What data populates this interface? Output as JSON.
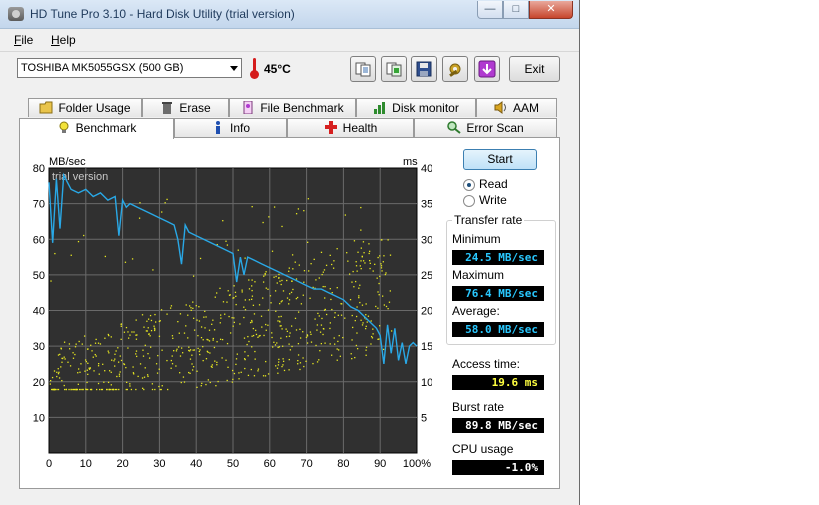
{
  "window": {
    "title": "HD Tune Pro 3.10 - Hard Disk Utility (trial version)",
    "controls": {
      "minimize": "—",
      "maximize": "□",
      "close": "✕"
    }
  },
  "menu": {
    "file": "File",
    "file_hotkey": "F",
    "file_rest": "ile",
    "help": "Help",
    "help_hotkey": "H",
    "help_rest": "elp"
  },
  "toolbar": {
    "drive": "TOSHIBA MK5055GSX (500 GB)",
    "temperature": "45°C",
    "exit_label": "Exit",
    "icons": [
      "copy-info-icon",
      "copy-screenshot-icon",
      "save-icon",
      "options-icon",
      "minimize-to-tray-icon"
    ]
  },
  "tabs": {
    "row1": [
      {
        "label": "Folder Usage",
        "icon": "folder-icon"
      },
      {
        "label": "Erase",
        "icon": "trash-icon"
      },
      {
        "label": "File Benchmark",
        "icon": "file-benchmark-icon"
      },
      {
        "label": "Disk monitor",
        "icon": "disk-monitor-icon"
      },
      {
        "label": "AAM",
        "icon": "speaker-icon"
      }
    ],
    "row2": [
      {
        "label": "Benchmark",
        "icon": "lightbulb-icon",
        "active": true
      },
      {
        "label": "Info",
        "icon": "info-icon"
      },
      {
        "label": "Health",
        "icon": "health-cross-icon"
      },
      {
        "label": "Error Scan",
        "icon": "magnifier-icon"
      }
    ]
  },
  "benchmark": {
    "start_label": "Start",
    "read_label": "Read",
    "write_label": "Write",
    "mode": "read",
    "transfer_rate_title": "Transfer rate",
    "minimum_label": "Minimum",
    "minimum_value": "24.5 MB/sec",
    "maximum_label": "Maximum",
    "maximum_value": "76.4 MB/sec",
    "average_label": "Average:",
    "average_value": "58.0 MB/sec",
    "access_time_label": "Access time:",
    "access_time_value": "19.6 ms",
    "burst_rate_label": "Burst rate",
    "burst_rate_value": "89.8 MB/sec",
    "cpu_usage_label": "CPU usage",
    "cpu_usage_value": "-1.0%",
    "value_color_cyan": "#29c8ff",
    "value_color_yellow": "#ffff40"
  },
  "chart_data": {
    "type": "line",
    "watermark": "trial version",
    "ylabel_left": "MB/sec",
    "ylabel_right": "ms",
    "ylim_left": [
      0,
      80
    ],
    "ylim_right": [
      0,
      40
    ],
    "xlim": [
      0,
      100
    ],
    "yticks_left": [
      "10",
      "20",
      "30",
      "40",
      "50",
      "60",
      "70",
      "80"
    ],
    "yticks_right": [
      "5",
      "10",
      "15",
      "20",
      "25",
      "30",
      "35",
      "40"
    ],
    "xticks": [
      "0",
      "10",
      "20",
      "30",
      "40",
      "50",
      "60",
      "70",
      "80",
      "90",
      "100%"
    ],
    "grid": true,
    "background": "#303030",
    "grid_color": "#6a6a6a",
    "series": [
      {
        "color": "#29a8e6",
        "x": [
          0,
          1,
          2,
          3,
          4,
          5,
          6,
          8,
          10,
          12,
          14,
          16,
          18,
          19,
          20,
          21,
          22,
          24,
          26,
          28,
          30,
          32,
          34,
          35,
          36,
          37,
          38,
          40,
          42,
          44,
          46,
          48,
          50,
          51,
          52,
          53,
          54,
          56,
          58,
          60,
          62,
          64,
          66,
          68,
          70,
          72,
          74,
          76,
          78,
          80,
          82,
          84,
          86,
          88,
          89,
          90,
          91,
          92,
          93,
          94,
          95,
          96,
          97,
          98,
          99,
          100
        ],
        "y": [
          76,
          59,
          77,
          63,
          78,
          76,
          74,
          73,
          74,
          72,
          73,
          71,
          72,
          61,
          71,
          69,
          70,
          69,
          68,
          67,
          66,
          65,
          64,
          60,
          53,
          64,
          62,
          61,
          60,
          59,
          58,
          57,
          56,
          48,
          55,
          50,
          55,
          54,
          53,
          52,
          51,
          50,
          49,
          48,
          47,
          46,
          46,
          45,
          44,
          43,
          41,
          40,
          38,
          36,
          35,
          33,
          25,
          36,
          28,
          35,
          26,
          31,
          25,
          30,
          31,
          30
        ]
      }
    ],
    "scatter": {
      "name": "access time",
      "color": "#e8e820",
      "x_range": [
        0,
        100
      ],
      "y_range_ms": [
        9,
        30
      ],
      "count": 700
    }
  }
}
